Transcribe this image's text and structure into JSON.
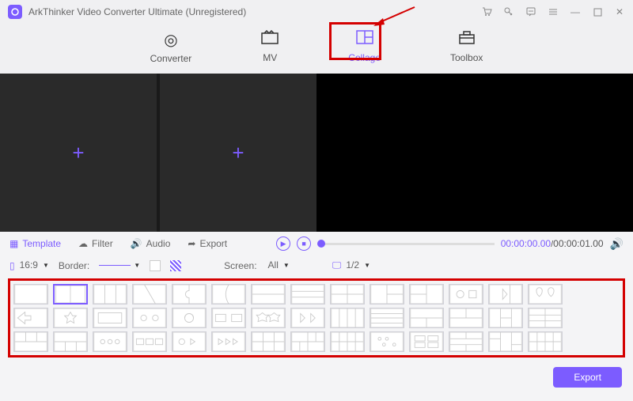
{
  "title": "ArkThinker Video Converter Ultimate (Unregistered)",
  "tabs": {
    "converter": "Converter",
    "mv": "MV",
    "collage": "Collage",
    "toolbox": "Toolbox"
  },
  "subtabs": {
    "template": "Template",
    "filter": "Filter",
    "audio": "Audio",
    "export": "Export"
  },
  "opts": {
    "ratio": "16:9",
    "border_label": "Border:",
    "screen_label": "Screen:",
    "screen_val": "All",
    "preview_ratio": "1/2"
  },
  "time": {
    "cur": "00:00:00.00",
    "total": "00:00:01.00"
  },
  "export_btn": "Export"
}
